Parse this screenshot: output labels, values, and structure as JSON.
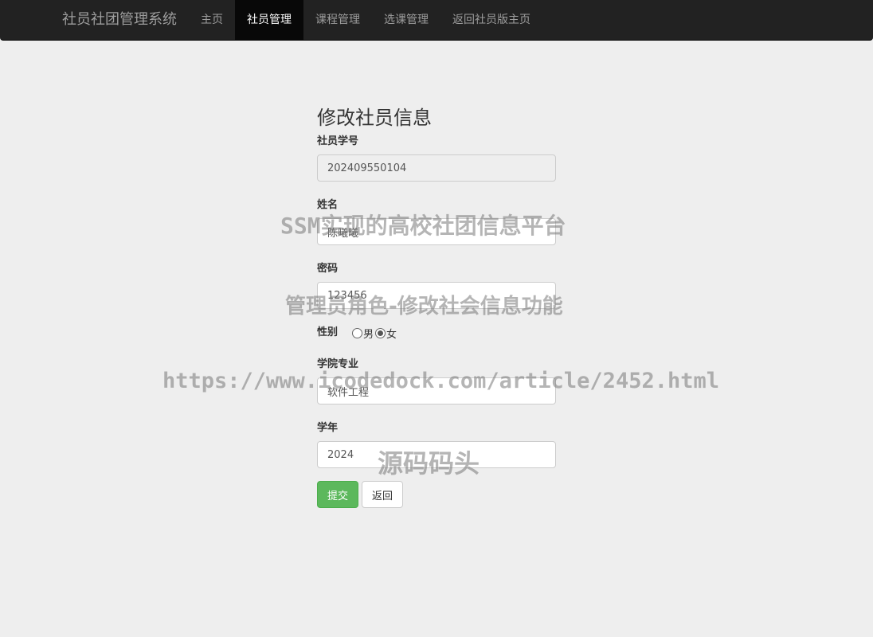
{
  "navbar": {
    "brand": "社员社团管理系统",
    "items": [
      {
        "label": "主页",
        "active": false
      },
      {
        "label": "社员管理",
        "active": true
      },
      {
        "label": "课程管理",
        "active": false
      },
      {
        "label": "选课管理",
        "active": false
      },
      {
        "label": "返回社员版主页",
        "active": false
      }
    ]
  },
  "form": {
    "title": "修改社员信息",
    "student_id": {
      "label": "社员学号",
      "value": "202409550104"
    },
    "name": {
      "label": "姓名",
      "value": "陈曦曦"
    },
    "password": {
      "label": "密码",
      "value": "123456"
    },
    "gender": {
      "label": "性别",
      "options": [
        "男",
        "女"
      ],
      "selected": "女"
    },
    "major": {
      "label": "学院专业",
      "value": "软件工程"
    },
    "year": {
      "label": "学年",
      "value": "2024"
    },
    "submit_label": "提交",
    "back_label": "返回"
  },
  "watermarks": {
    "line1": "SSM实现的高校社团信息平台",
    "line2": "管理员角色-修改社会信息功能",
    "line3": "https://www.icodedock.com/article/2452.html",
    "line4": "源码码头"
  },
  "colors": {
    "navbar_bg": "#222222",
    "nav_active_bg": "#080808",
    "page_bg": "#eeeeee",
    "submit_green": "#5cb85c"
  }
}
